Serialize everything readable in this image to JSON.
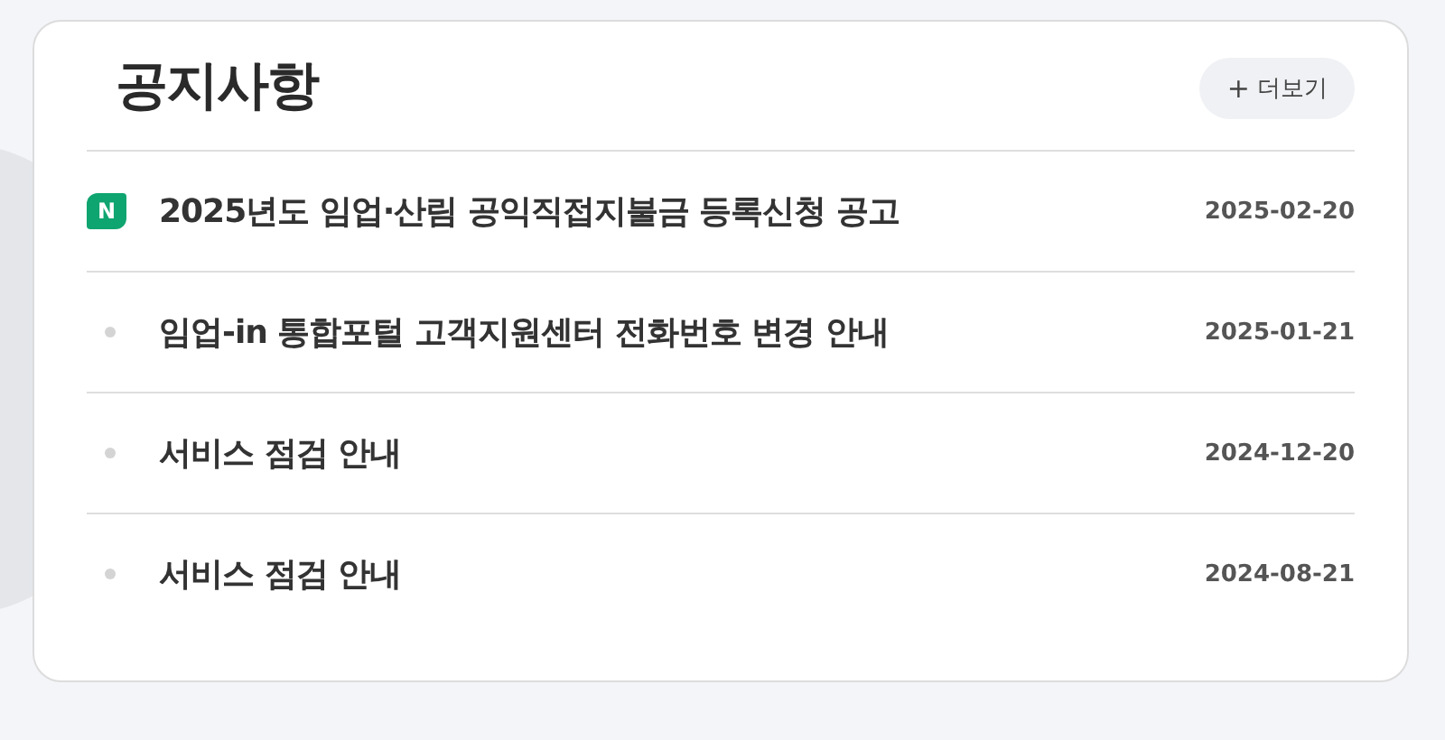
{
  "notice_board": {
    "title": "공지사항",
    "more_button": {
      "icon": "+",
      "label": "더보기"
    },
    "items": [
      {
        "kind": "new",
        "badge": "N",
        "title": "2025년도 임업·산림 공익직접지불금 등록신청 공고",
        "date": "2025-02-20"
      },
      {
        "kind": "normal",
        "title": "임업-in 통합포털 고객지원센터 전화번호 변경 안내",
        "date": "2025-01-21"
      },
      {
        "kind": "normal",
        "title": "서비스 점검 안내",
        "date": "2024-12-20"
      },
      {
        "kind": "normal",
        "title": "서비스 점검 안내",
        "date": "2024-08-21"
      }
    ]
  }
}
